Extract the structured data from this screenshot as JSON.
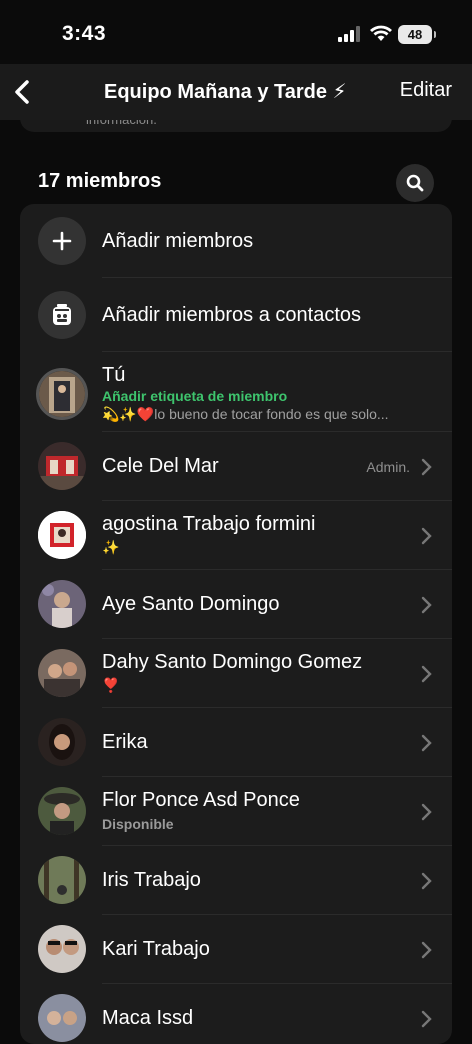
{
  "status": {
    "time": "3:43",
    "battery": "48"
  },
  "header": {
    "title": "Equipo Mañana y Tarde ⚡",
    "edit": "Editar"
  },
  "info_text": "informacion.",
  "members_count": "17 miembros",
  "actions": [
    {
      "label": "Añadir miembros",
      "icon": "plus-icon"
    },
    {
      "label": "Añadir miembros a contactos",
      "icon": "contact-card-icon"
    }
  ],
  "self": {
    "name": "Tú",
    "tag": "Añadir etiqueta de miembro",
    "status": "💫✨❤️lo bueno de tocar fondo es que solo..."
  },
  "members": [
    {
      "name": "Cele Del Mar",
      "sub": "",
      "role": "Admin."
    },
    {
      "name": "agostina Trabajo formini",
      "sub": "✨",
      "role": ""
    },
    {
      "name": "Aye Santo Domingo",
      "sub": "",
      "role": ""
    },
    {
      "name": "Dahy Santo Domingo Gomez",
      "sub": "❣️",
      "role": ""
    },
    {
      "name": "Erika",
      "sub": "",
      "role": ""
    },
    {
      "name": "Flor  Ponce Asd Ponce",
      "sub": "Disponible",
      "role": ""
    },
    {
      "name": "Iris Trabajo",
      "sub": "",
      "role": ""
    },
    {
      "name": "Kari Trabajo",
      "sub": "",
      "role": ""
    },
    {
      "name": "Maca Issd",
      "sub": "",
      "role": ""
    }
  ],
  "colors": {
    "accent_green": "#3ec46d",
    "background": "#0b0b0b",
    "card": "#1c1c1c"
  }
}
